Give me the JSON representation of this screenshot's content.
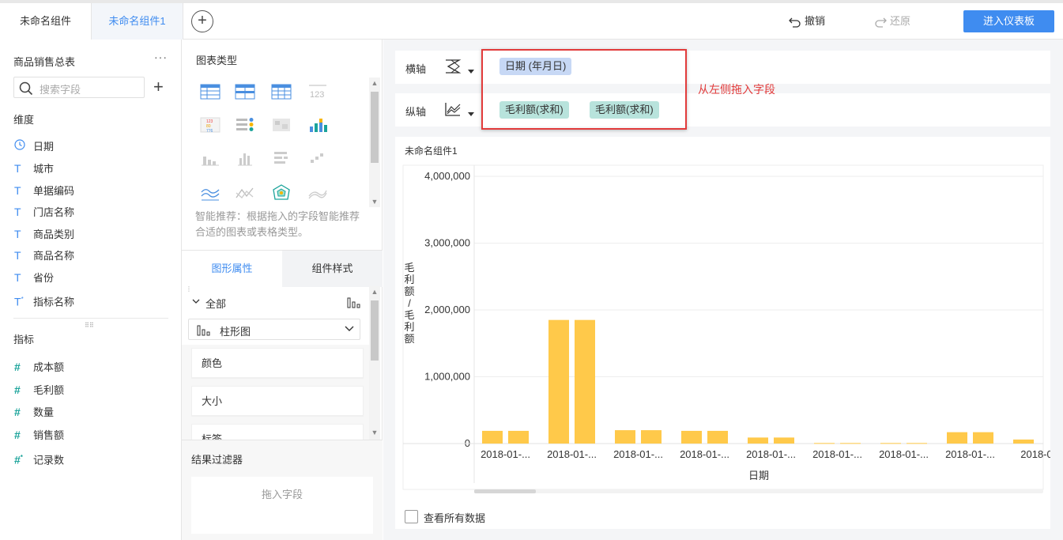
{
  "tabs": [
    {
      "label": "未命名组件",
      "active": false
    },
    {
      "label": "未命名组件1",
      "active": true
    }
  ],
  "toolbar": {
    "undo_label": "撤销",
    "redo_label": "还原",
    "enter_label": "进入仪表板"
  },
  "left": {
    "dataset_title": "商品销售总表",
    "more": "···",
    "search_placeholder": "搜索字段",
    "dimension_label": "维度",
    "dimensions": [
      {
        "icon": "clock-icon",
        "label": "日期"
      },
      {
        "icon": "text-icon",
        "label": "城市"
      },
      {
        "icon": "text-icon",
        "label": "单据编码"
      },
      {
        "icon": "text-icon",
        "label": "门店名称"
      },
      {
        "icon": "text-icon",
        "label": "商品类别"
      },
      {
        "icon": "text-icon",
        "label": "商品名称"
      },
      {
        "icon": "text-icon",
        "label": "省份"
      },
      {
        "icon": "text-star-icon",
        "label": "指标名称"
      }
    ],
    "measure_label": "指标",
    "measures": [
      {
        "icon": "hash-icon",
        "label": "成本额"
      },
      {
        "icon": "hash-icon",
        "label": "毛利额"
      },
      {
        "icon": "hash-icon",
        "label": "数量"
      },
      {
        "icon": "hash-icon",
        "label": "销售额"
      },
      {
        "icon": "hash-star-icon",
        "label": "记录数"
      }
    ]
  },
  "middle": {
    "chart_type_title": "图表类型",
    "hint": "智能推荐：根据拖入的字段智能推荐合适的图表或表格类型。",
    "tab_shape": "图形属性",
    "tab_style": "组件样式",
    "all_label": "全部",
    "chart_type_value": "柱形图",
    "props": [
      "颜色",
      "大小",
      "标签"
    ],
    "filter_title": "结果过滤器",
    "filter_placeholder": "拖入字段"
  },
  "axes": {
    "x_label": "横轴",
    "y_label": "纵轴",
    "x_fields": [
      "日期 (年月日)"
    ],
    "y_fields": [
      "毛利额(求和)",
      "毛利额(求和)"
    ],
    "annotation": "从左侧拖入字段"
  },
  "chart_data": {
    "type": "bar",
    "title": "未命名组件1",
    "xlabel": "日期",
    "ylabel": "毛利额/毛利额",
    "ylim": [
      0,
      4000000
    ],
    "yticks": [
      "4,000,000",
      "3,000,000",
      "2,000,000",
      "1,000,000",
      "0"
    ],
    "categories": [
      "2018-01-...",
      "2018-01-...",
      "2018-01-...",
      "2018-01-...",
      "2018-01-...",
      "2018-01-...",
      "2018-01-...",
      "2018-01-...",
      "2018-0"
    ],
    "series": [
      {
        "values": [
          190000,
          1850000,
          200000,
          190000,
          90000,
          8000,
          8000,
          170000,
          60000
        ]
      },
      {
        "values": [
          190000,
          1850000,
          200000,
          190000,
          90000,
          8000,
          8000,
          170000,
          60000
        ]
      }
    ],
    "bar_color": "#ffc94a"
  },
  "footer": {
    "view_all_label": "查看所有数据"
  }
}
